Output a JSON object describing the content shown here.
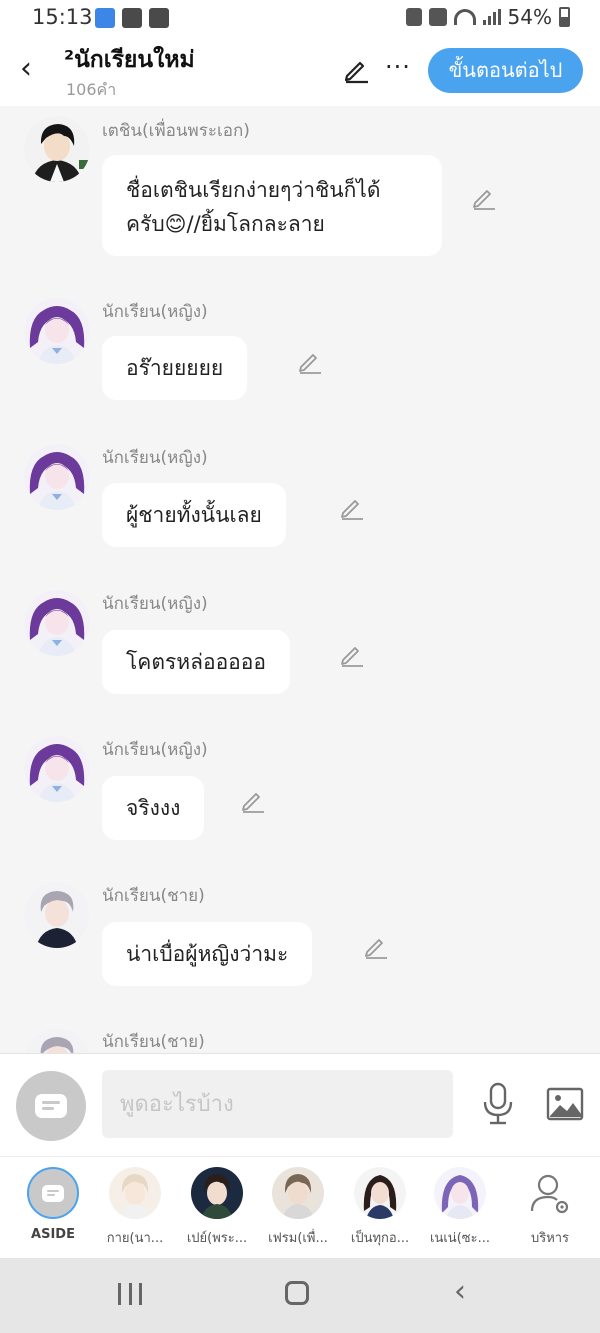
{
  "status_bar": {
    "time": "15:13",
    "battery": "54%"
  },
  "header": {
    "back_icon": "‹",
    "title": "²นักเรียนใหม่",
    "subtitle": "106คำ",
    "next_button": "ขั้นตอนต่อไป",
    "more_icon": "···"
  },
  "messages": [
    {
      "sender": "เตชิน(เพื่อนพระเอก)",
      "lines": [
        "ชื่อเตชินเรียกง่ายๆว่าชินก็ได้",
        "ครับ😊//ยิ้มโลกละลาย"
      ],
      "avatar": "male-dark"
    },
    {
      "sender": "นักเรียน(หญิง)",
      "lines": [
        "อร๊ายยยยย"
      ],
      "avatar": "female-purple"
    },
    {
      "sender": "นักเรียน(หญิง)",
      "lines": [
        "ผู้ชายทั้งนั้นเลย"
      ],
      "avatar": "female-purple"
    },
    {
      "sender": "นักเรียน(หญิง)",
      "lines": [
        "โคตรหล่อออออ"
      ],
      "avatar": "female-purple"
    },
    {
      "sender": "นักเรียน(หญิง)",
      "lines": [
        "จริงงง"
      ],
      "avatar": "female-purple"
    },
    {
      "sender": "นักเรียน(ชาย)",
      "lines": [
        "น่าเบื่อผู้หญิงว่ามะ"
      ],
      "avatar": "male-grey"
    },
    {
      "sender": "นักเรียน(ชาย)",
      "lines": [],
      "avatar": "male-grey"
    }
  ],
  "input": {
    "placeholder": "พูดอะไรบ้าง"
  },
  "characters": [
    {
      "label": "ASIDE"
    },
    {
      "label": "กาย(นา..."
    },
    {
      "label": "เปย์(พระ..."
    },
    {
      "label": "เฟรม(เพื่..."
    },
    {
      "label": "เป็นทุกอ..."
    },
    {
      "label": "เนเน่(ซะ..."
    },
    {
      "label": "บริหาร"
    }
  ],
  "colors": {
    "accent": "#4aa3ee",
    "bubble": "#ffffff",
    "background": "#f5f5f5"
  }
}
